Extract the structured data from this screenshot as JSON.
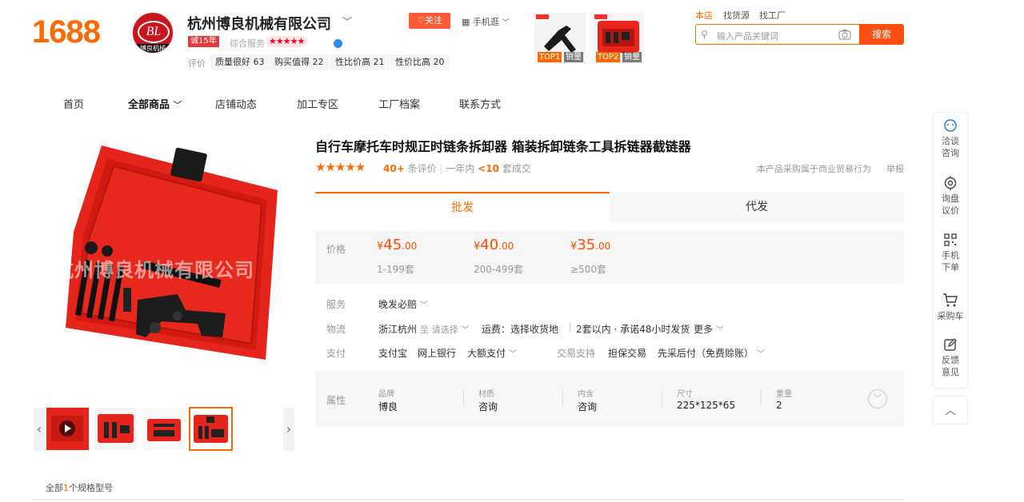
{
  "header": {
    "logo": "1688",
    "shop_avatar_text": "BL",
    "shop_avatar_strip": "博良机械",
    "shop_name": "杭州博良机械有限公司",
    "years_badge": "诚15年",
    "composite_label": "综合服务",
    "composite_stars": "★★★★★",
    "rating_label": "评价",
    "rating_tags": [
      {
        "label": "质量很好 63"
      },
      {
        "label": "购买值得 22"
      },
      {
        "label": "性比价高 21"
      },
      {
        "label": "性价比高 20"
      }
    ],
    "follow_label": "♡关注",
    "mobile_label": "手机逛",
    "top_products": [
      {
        "rank": "TOP1",
        "tag": "销量"
      },
      {
        "rank": "TOP2",
        "tag": "销量"
      }
    ],
    "search_tabs": [
      "本店",
      "找货源",
      "找工厂"
    ],
    "search_placeholder": "输入产品关键词",
    "search_button": "搜索"
  },
  "nav": {
    "items": [
      "首页",
      "全部商品",
      "店铺动态",
      "加工专区",
      "工厂档案",
      "联系方式"
    ],
    "active": "全部商品"
  },
  "gallery": {
    "watermark": "杭州博良机械有限公司",
    "thumb_count": 4,
    "active_thumb": 4
  },
  "product": {
    "title": "自行车摩托车时规正时链条拆卸器 箱装拆卸链条工具拆链器截链器",
    "stars": "★★★★★",
    "reviews_count": "40+",
    "reviews_label": "条评价",
    "year_label": "一年内",
    "sold": "<10",
    "sold_label": "套成交",
    "biz_note": "本产品采购属于商业贸易行为",
    "report": "举报",
    "tabs": [
      "批发",
      "代发"
    ],
    "price_label": "价格",
    "prices": [
      {
        "int": "45",
        "dec": ".00",
        "range": "1-199套"
      },
      {
        "int": "40",
        "dec": ".00",
        "range": "200-499套"
      },
      {
        "int": "35",
        "dec": ".00",
        "range": "≥500套"
      }
    ],
    "currency": "¥",
    "service_label": "服务",
    "service_value": "晚发必赔",
    "logistics_label": "物流",
    "logistics_from": "浙江杭州",
    "logistics_to_label": "至",
    "logistics_to_select": "请选择",
    "logistics_fee": "运费：选择收货地",
    "logistics_promise": "2套以内 · 承诺48小时发货",
    "logistics_more": "更多",
    "pay_label": "支付",
    "pay_methods": [
      "支付宝",
      "网上银行",
      "大额支付"
    ],
    "trade_label": "交易支持",
    "trade_methods": [
      "担保交易",
      "先采后付（免费赊账）"
    ],
    "attr_label": "属性",
    "attributes": [
      {
        "k": "品牌",
        "v": "博良"
      },
      {
        "k": "材质",
        "v": "咨询"
      },
      {
        "k": "内含",
        "v": "咨询"
      },
      {
        "k": "尺寸",
        "v": "225*125*65"
      },
      {
        "k": "重量",
        "v": "2"
      }
    ],
    "spec_prefix": "全部",
    "spec_count": "1",
    "spec_suffix": "个规格型号"
  },
  "sidebar": {
    "items": [
      {
        "label1": "洽谈",
        "label2": "咨询",
        "icon": "chat-icon"
      },
      {
        "label1": "询盘",
        "label2": "议价",
        "icon": "target-icon"
      },
      {
        "label1": "手机",
        "label2": "下单",
        "icon": "qrcode-icon"
      },
      {
        "label1": "采购车",
        "label2": "",
        "icon": "cart-icon"
      },
      {
        "label1": "反馈",
        "label2": "意见",
        "icon": "edit-icon"
      }
    ]
  },
  "colors": {
    "brand": "#ff6a00",
    "price": "#ff4d00",
    "search_button": "#ff4e0f"
  }
}
